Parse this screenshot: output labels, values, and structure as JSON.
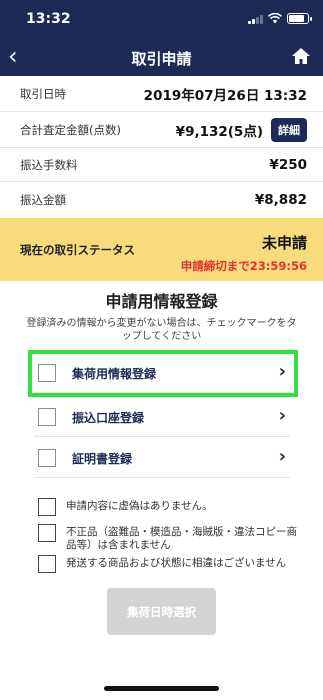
{
  "status_bar": {
    "time": "13:32"
  },
  "nav": {
    "title": "取引申請"
  },
  "info_rows": {
    "date_label": "取引日時",
    "date_value": "2019年07月26日 13:32",
    "total_label": "合計査定金額(点数)",
    "total_value": "¥9,132(5点)",
    "detail_button": "詳細",
    "fee_label": "振込手数料",
    "fee_value": "¥250",
    "transfer_label": "振込金額",
    "transfer_value": "¥8,882"
  },
  "status": {
    "label": "現在の取引ステータス",
    "value": "未申請",
    "deadline": "申請締切まで23:59:56"
  },
  "registration": {
    "title": "申請用情報登録",
    "description": "登録済みの情報から変更がない場合は、チェックマークをタップしてください",
    "items": [
      {
        "label": "集荷用情報登録"
      },
      {
        "label": "振込口座登録"
      },
      {
        "label": "証明書登録"
      }
    ]
  },
  "agreements": [
    {
      "label": "申請内容に虚偽はありません。"
    },
    {
      "label": "不正品（盗難品・模造品・海賊版・違法コピー商品等）は含まれません"
    },
    {
      "label": "発送する商品および状態に相違はございません"
    }
  ],
  "submit_button": "集荷日時選択",
  "colors": {
    "navy": "#1e2a55",
    "status_bg": "#f8db7d",
    "deadline_red": "#e0342f",
    "highlight_green": "#31e042",
    "disabled_button": "#d3d3d3"
  }
}
